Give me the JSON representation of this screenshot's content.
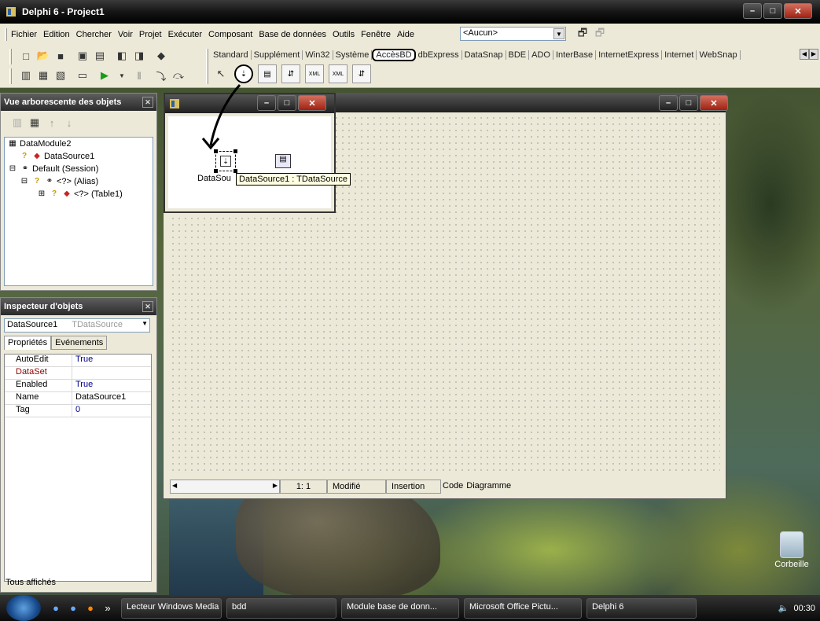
{
  "main_window": {
    "title": "Delphi 6 - Project1",
    "menu": [
      "Fichier",
      "Edition",
      "Chercher",
      "Voir",
      "Projet",
      "Exécuter",
      "Composant",
      "Base de données",
      "Outils",
      "Fenêtre",
      "Aide"
    ],
    "config_combo": "<Aucun>",
    "palette_tabs": [
      "Standard",
      "Supplément",
      "Win32",
      "Système",
      "AccèsBD",
      "dbExpress",
      "DataSnap",
      "BDE",
      "ADO",
      "InterBase",
      "InternetExpress",
      "Internet",
      "WebSnap"
    ],
    "active_palette_tab": "AccèsBD",
    "component_icons": [
      "pointer-icon",
      "datasource-icon",
      "clientdataset-icon",
      "datasetprovider-icon",
      "xmltransform-icon",
      "xmltransformprovider-icon",
      "xmltransformclient-icon"
    ]
  },
  "object_tree": {
    "title": "Vue arborescente des objets",
    "items": [
      {
        "label": "DataModule2",
        "icon": "datamodule-icon"
      },
      {
        "label": "DataSource1",
        "icon": "datasource-warning-icon"
      },
      {
        "label": "Default (Session)",
        "icon": "session-icon"
      },
      {
        "label": "<?> (Alias)",
        "icon": "alias-icon"
      },
      {
        "label": "<?> (Table1)",
        "icon": "table-icon"
      }
    ]
  },
  "inspector": {
    "title": "Inspecteur d'objets",
    "object_name": "DataSource1",
    "object_type": "TDataSource",
    "tabs": [
      "Propriétés",
      "Evénements"
    ],
    "properties": [
      {
        "key": "AutoEdit",
        "value": "True"
      },
      {
        "key": "DataSet",
        "value": ""
      },
      {
        "key": "Enabled",
        "value": "True"
      },
      {
        "key": "Name",
        "value": "DataSource1"
      },
      {
        "key": "Tag",
        "value": "0"
      }
    ],
    "status": "Tous affichés"
  },
  "form_window": {
    "status": {
      "position": "1: 1",
      "modified": "Modifié",
      "mode": "Insertion",
      "tab_code": "Code",
      "tab_diagram": "Diagramme"
    }
  },
  "data_module": {
    "component_label": "DataSou",
    "tooltip": "DataSource1 : TDataSource"
  },
  "desktop": {
    "recycle_bin": "Corbeille"
  },
  "taskbar": {
    "items": [
      "Lecteur Windows Media",
      "bdd",
      "Module base de donn...",
      "Microsoft Office Pictu...",
      "Delphi 6"
    ],
    "clock": "00:30"
  }
}
